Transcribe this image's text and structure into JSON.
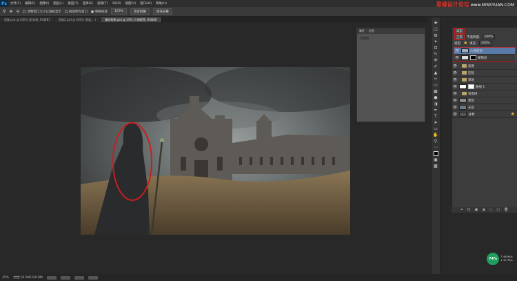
{
  "app": {
    "logo": "Ps"
  },
  "menu": [
    "文件(F)",
    "编辑(E)",
    "图像(I)",
    "图层(L)",
    "类型(Y)",
    "选择(S)",
    "滤镜(T)",
    "3D(D)",
    "视图(V)",
    "窗口(W)",
    "帮助(H)"
  ],
  "watermark": {
    "brand": "思缘设计论坛",
    "url": "www.MISSYUAN.COM"
  },
  "options": {
    "check1": "调整窗口大小以满屏显示",
    "check2": "缩放所有窗口",
    "check3": "细微缩放",
    "btn1": "100%",
    "btn2": "适合屏幕",
    "btn3": "填充屏幕"
  },
  "tabs": [
    {
      "label": "思路.psd @ 200% (羽化线, RGB/8)",
      "active": false
    },
    {
      "label": "思路2.psd @ 200% (图层 ...)",
      "active": false
    },
    {
      "label": "最终效果.psd @ 25% (人物提亮, RGB/8)",
      "active": true
    }
  ],
  "properties": {
    "tab1": "属性",
    "tab2": "信息",
    "empty": "无属性"
  },
  "layers": {
    "kind_select": "类型",
    "mode_select": "正常",
    "opacity_label": "不透明度:",
    "opacity": "100%",
    "lock_label": "锁定:",
    "fill_label": "填充:",
    "fill": "100%",
    "items": [
      {
        "name": "人物提亮",
        "type": "layer",
        "selected": true
      },
      {
        "name": "蒙版层",
        "type": "masked",
        "selected": false
      },
      {
        "name": "氛围",
        "type": "folder",
        "selected": false
      },
      {
        "name": "压暗",
        "type": "folder",
        "selected": false
      },
      {
        "name": "草地",
        "type": "folder",
        "selected": false
      },
      {
        "name": "曲线 1",
        "type": "adjust",
        "selected": false
      },
      {
        "name": "背景树",
        "type": "folder",
        "selected": false
      },
      {
        "name": "建筑",
        "type": "layer",
        "selected": false
      },
      {
        "name": "天空",
        "type": "layer",
        "selected": false
      },
      {
        "name": "背景",
        "type": "bg",
        "selected": false
      }
    ]
  },
  "status": {
    "zoom": "25%",
    "doc": "文档:19.5M/329.8M"
  },
  "speed": {
    "percent": "74%",
    "up": "↑ 46.9K/s",
    "down": "↓ 47.7K/s"
  },
  "colors": {
    "highlight": "#c81e1e",
    "selection": "#5a7aa8"
  }
}
